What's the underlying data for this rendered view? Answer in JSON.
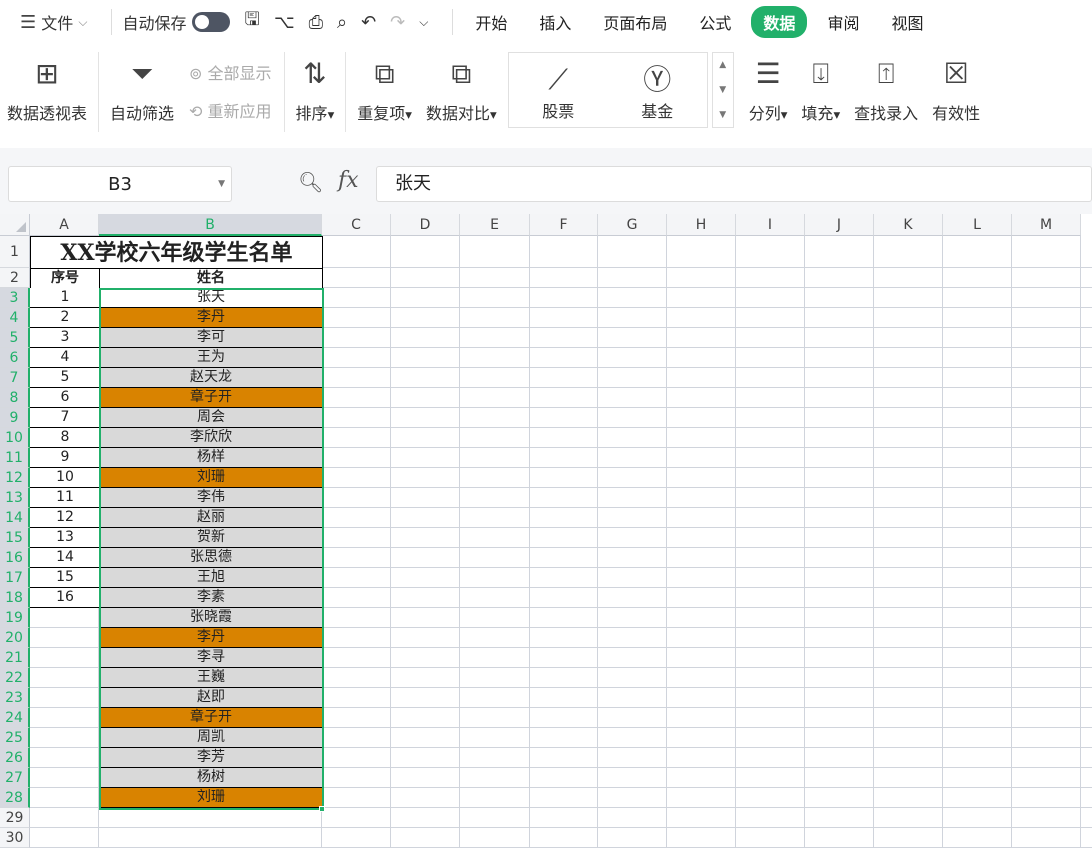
{
  "topbar": {
    "menu_label": "文件",
    "autosave_label": "自动保存",
    "autosave_on": false,
    "tabs": [
      {
        "label": "开始"
      },
      {
        "label": "插入"
      },
      {
        "label": "页面布局"
      },
      {
        "label": "公式"
      },
      {
        "label": "数据",
        "active": true
      },
      {
        "label": "审阅"
      },
      {
        "label": "视图"
      }
    ]
  },
  "ribbon": {
    "pivot": "数据透视表",
    "autofilter": "自动筛选",
    "show_all": "全部显示",
    "reapply": "重新应用",
    "sort": "排序",
    "duplicates": "重复项",
    "compare": "数据对比",
    "stocks": "股票",
    "funds": "基金",
    "split": "分列",
    "fill": "填充",
    "lookup": "查找录入",
    "validity": "有效性"
  },
  "formula_bar": {
    "name_box": "B3",
    "fx": "fx",
    "value": "张天"
  },
  "colors": {
    "accent": "#21b06a",
    "highlight": "#d98300",
    "cell_gray": "#d9d9d9"
  },
  "sheet": {
    "columns": [
      "A",
      "B",
      "C",
      "D",
      "E",
      "F",
      "G",
      "H",
      "I",
      "J",
      "K",
      "L",
      "M"
    ],
    "title": "XX学校六年级学生名单",
    "header": {
      "no": "序号",
      "name": "姓名"
    },
    "rows": [
      {
        "no": "1",
        "name": "张天",
        "fill": "white"
      },
      {
        "no": "2",
        "name": "李丹",
        "fill": "orange"
      },
      {
        "no": "3",
        "name": "李可",
        "fill": "gray"
      },
      {
        "no": "4",
        "name": "王为",
        "fill": "gray"
      },
      {
        "no": "5",
        "name": "赵天龙",
        "fill": "gray"
      },
      {
        "no": "6",
        "name": "章子开",
        "fill": "orange"
      },
      {
        "no": "7",
        "name": "周会",
        "fill": "gray"
      },
      {
        "no": "8",
        "name": "李欣欣",
        "fill": "gray"
      },
      {
        "no": "9",
        "name": "杨样",
        "fill": "gray"
      },
      {
        "no": "10",
        "name": "刘珊",
        "fill": "orange"
      },
      {
        "no": "11",
        "name": "李伟",
        "fill": "gray"
      },
      {
        "no": "12",
        "name": "赵丽",
        "fill": "gray"
      },
      {
        "no": "13",
        "name": "贺新",
        "fill": "gray"
      },
      {
        "no": "14",
        "name": "张思德",
        "fill": "gray"
      },
      {
        "no": "15",
        "name": "王旭",
        "fill": "gray"
      },
      {
        "no": "16",
        "name": "李素",
        "fill": "gray"
      },
      {
        "no": "",
        "name": "张晓霞",
        "fill": "gray"
      },
      {
        "no": "",
        "name": "李丹",
        "fill": "orange"
      },
      {
        "no": "",
        "name": "李寻",
        "fill": "gray"
      },
      {
        "no": "",
        "name": "王巍",
        "fill": "gray"
      },
      {
        "no": "",
        "name": "赵即",
        "fill": "gray"
      },
      {
        "no": "",
        "name": "章子开",
        "fill": "orange"
      },
      {
        "no": "",
        "name": "周凯",
        "fill": "gray"
      },
      {
        "no": "",
        "name": "李芳",
        "fill": "gray"
      },
      {
        "no": "",
        "name": "杨树",
        "fill": "gray"
      },
      {
        "no": "",
        "name": "刘珊",
        "fill": "orange"
      }
    ]
  }
}
